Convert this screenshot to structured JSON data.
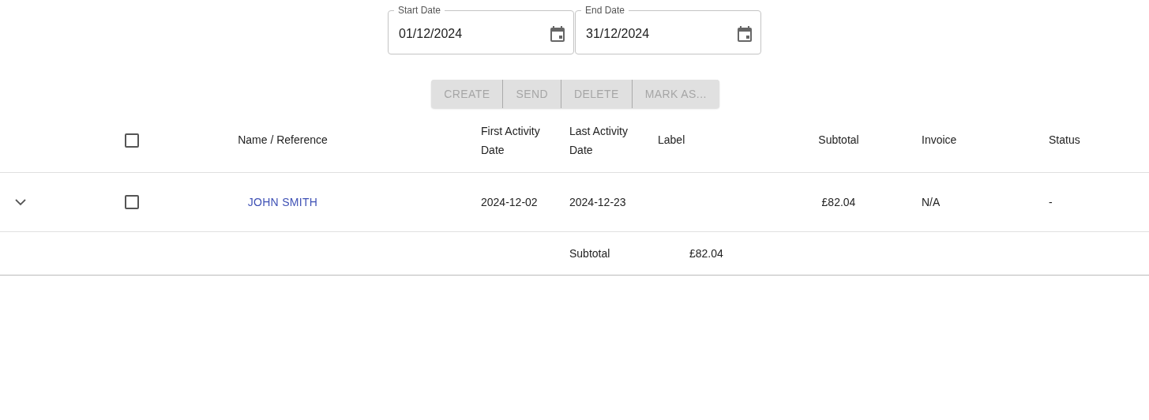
{
  "date_fields": [
    {
      "label": "Start Date",
      "value": "01/12/2024"
    },
    {
      "label": "End Date",
      "value": "31/12/2024"
    }
  ],
  "actions": [
    {
      "label": "CREATE",
      "disabled": true
    },
    {
      "label": "SEND",
      "disabled": true
    },
    {
      "label": "DELETE",
      "disabled": true
    },
    {
      "label": "MARK AS...",
      "disabled": true
    }
  ],
  "table": {
    "select_all_checked": false,
    "columns": [
      "Name / Reference",
      "First Activity Date",
      "Last Activity Date",
      "Label",
      "Subtotal",
      "Invoice",
      "Status"
    ],
    "rows": [
      {
        "expanded": false,
        "checked": false,
        "name": "JOHN SMITH",
        "first_activity": "2024-12-02",
        "last_activity": "2024-12-23",
        "label": "",
        "subtotal": "£82.04",
        "invoice": "N/A",
        "status": "-"
      }
    ],
    "footer": {
      "label": "Subtotal",
      "value": "£82.04"
    }
  }
}
